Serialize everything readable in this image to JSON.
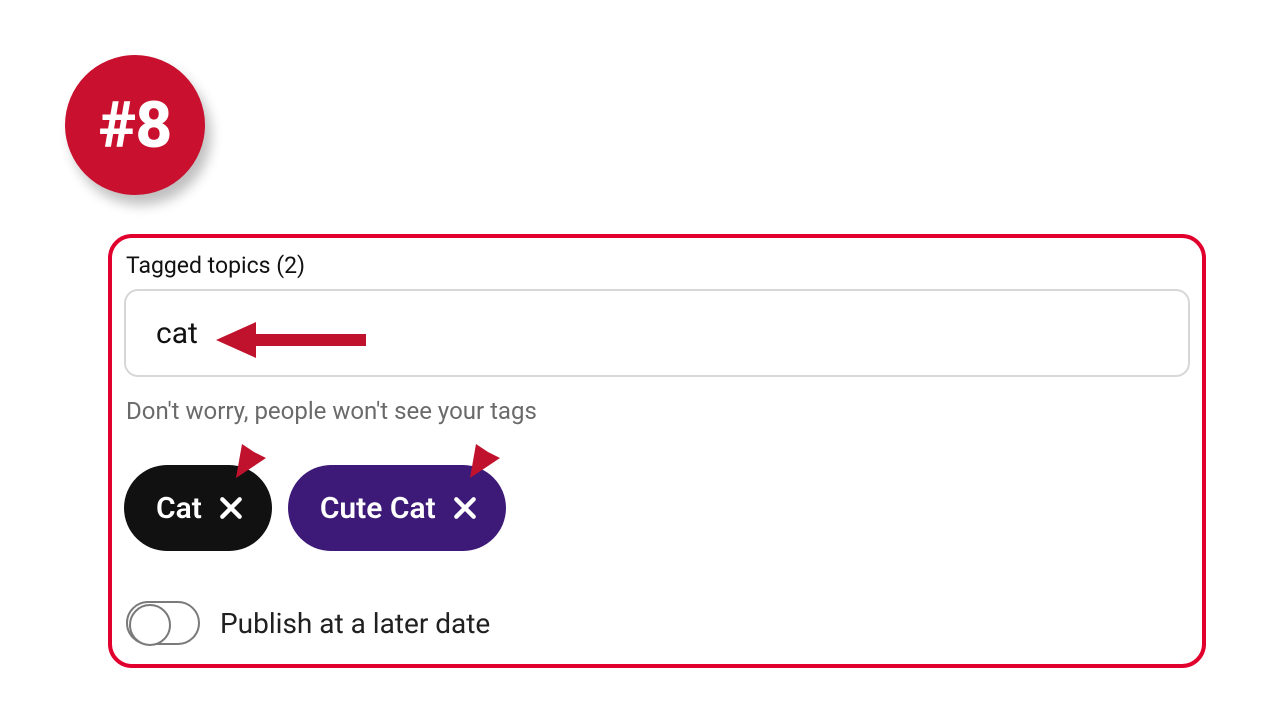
{
  "badge": {
    "label": "#8"
  },
  "tagged_topics": {
    "label": "Tagged topics (2)",
    "input_value": "cat",
    "hint": "Don't worry, people won't see your tags",
    "chips": [
      {
        "label": "Cat"
      },
      {
        "label": "Cute Cat"
      }
    ]
  },
  "publish_toggle": {
    "label": "Publish at a later date",
    "state": "off"
  },
  "colors": {
    "accent_red": "#c9102e",
    "callout_border": "#e1002d",
    "chip_black": "#111111",
    "chip_purple": "#3d1a78"
  }
}
